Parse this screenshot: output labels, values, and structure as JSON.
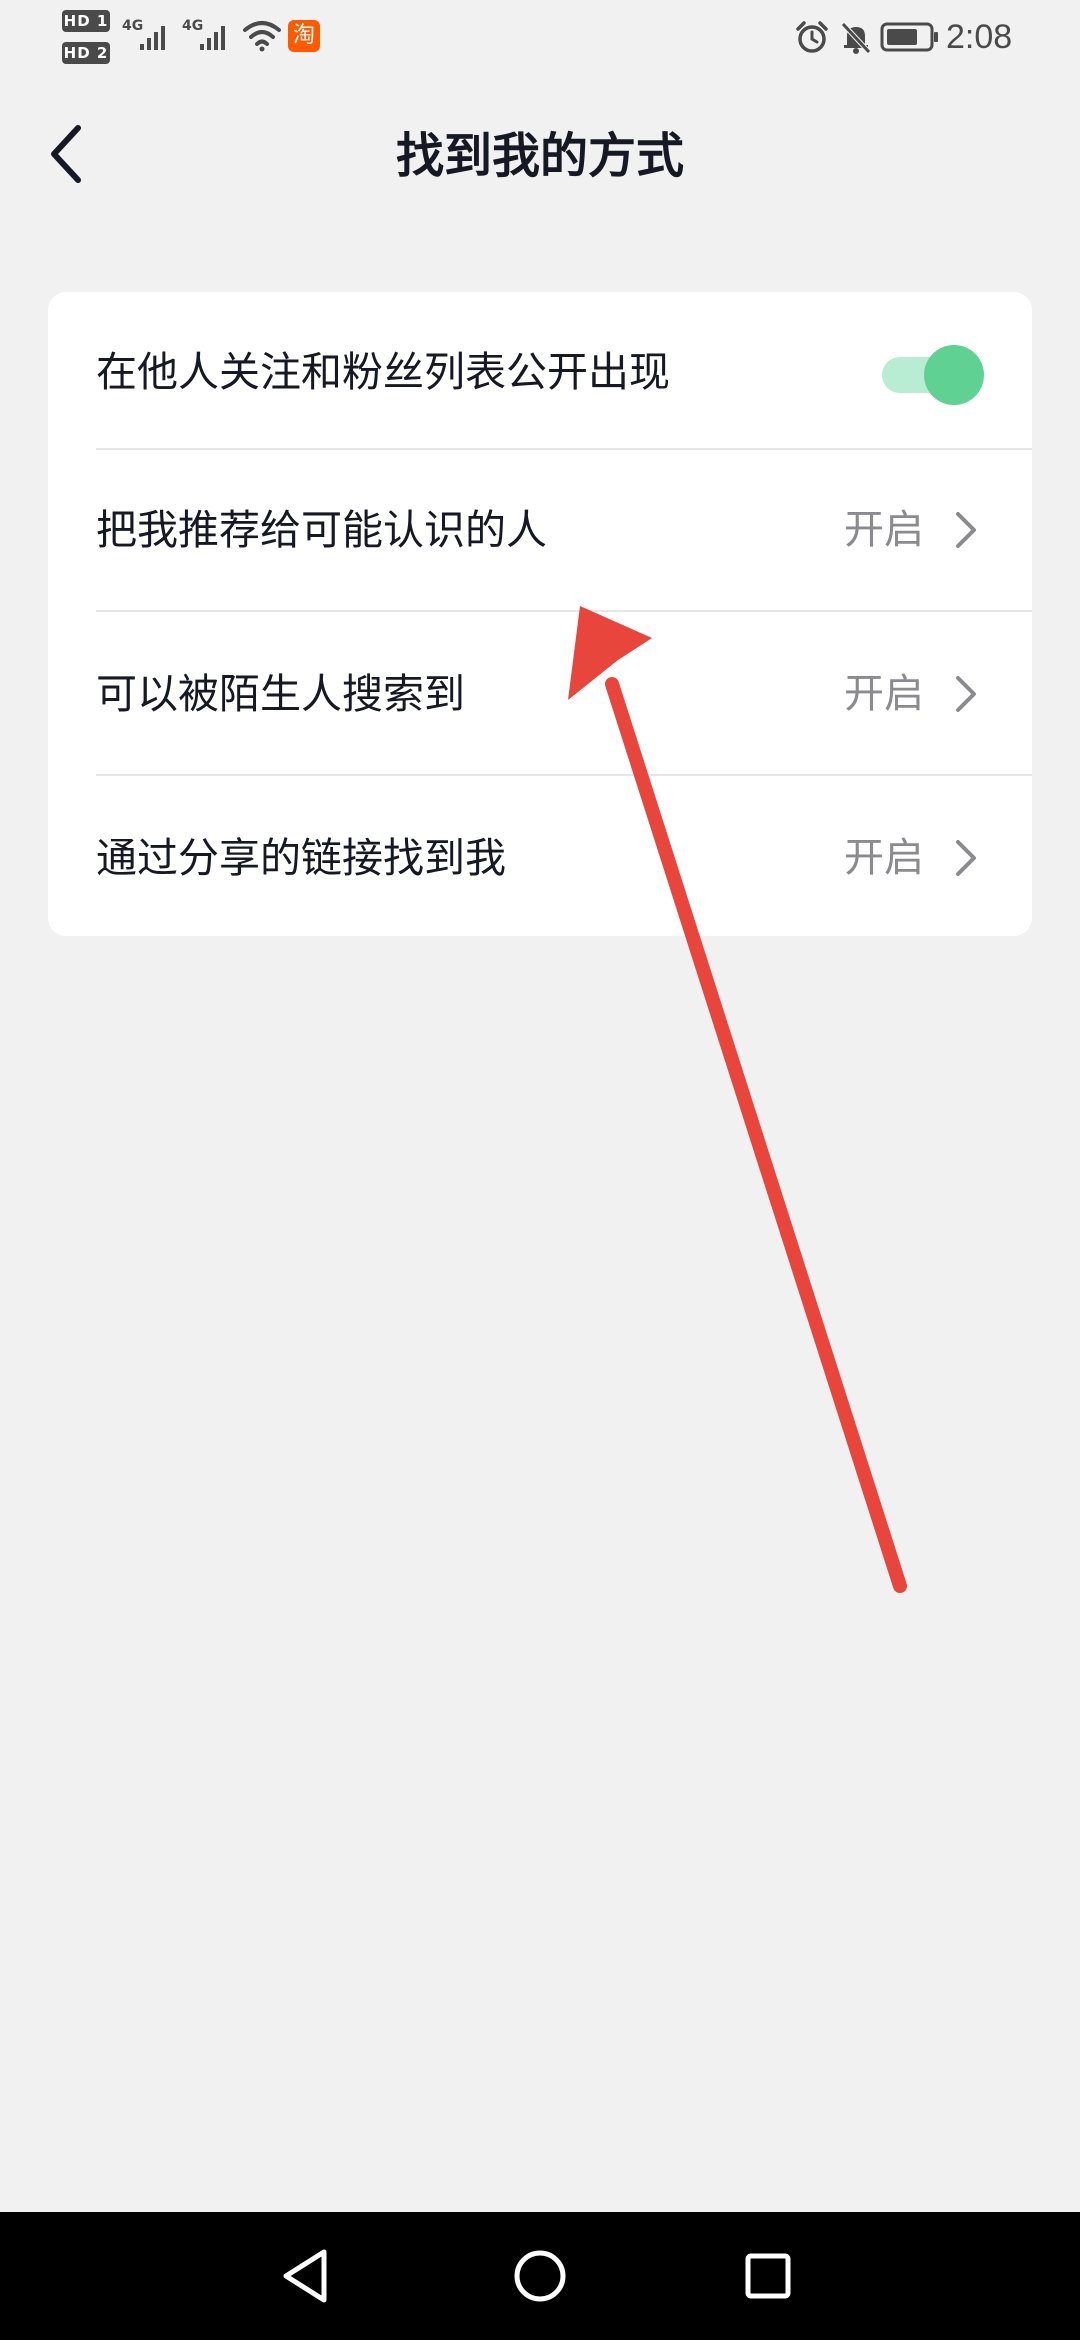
{
  "status_bar": {
    "sim1_badge": "HD 1",
    "sim2_badge": "HD 2",
    "network1": "4G",
    "network2": "4G",
    "taobao_badge": "淘",
    "time": "2:08",
    "icons": [
      "signal-icon",
      "wifi-icon",
      "taobao-app-icon",
      "alarm-icon",
      "mute-icon",
      "battery-icon"
    ]
  },
  "header": {
    "title": "找到我的方式",
    "back_icon": "chevron-left-icon"
  },
  "settings": {
    "items": [
      {
        "label": "在他人关注和粉丝列表公开出现",
        "control": "toggle",
        "toggle_on": true
      },
      {
        "label": "把我推荐给可能认识的人",
        "value": "开启",
        "control": "chevron"
      },
      {
        "label": "可以被陌生人搜索到",
        "value": "开启",
        "control": "chevron"
      },
      {
        "label": "通过分享的链接找到我",
        "value": "开启",
        "control": "chevron"
      }
    ]
  },
  "navigation": {
    "buttons": [
      "back-triangle-icon",
      "home-circle-icon",
      "recents-square-icon"
    ]
  },
  "colors": {
    "background": "#f2f1f2",
    "card": "#ffffff",
    "title_text": "#161823",
    "secondary_text": "#8a8a8f",
    "toggle_track": "#b8ecd3",
    "toggle_knob": "#5ed193",
    "annotation_arrow": "#e8453c",
    "nav_bar": "#000000"
  }
}
